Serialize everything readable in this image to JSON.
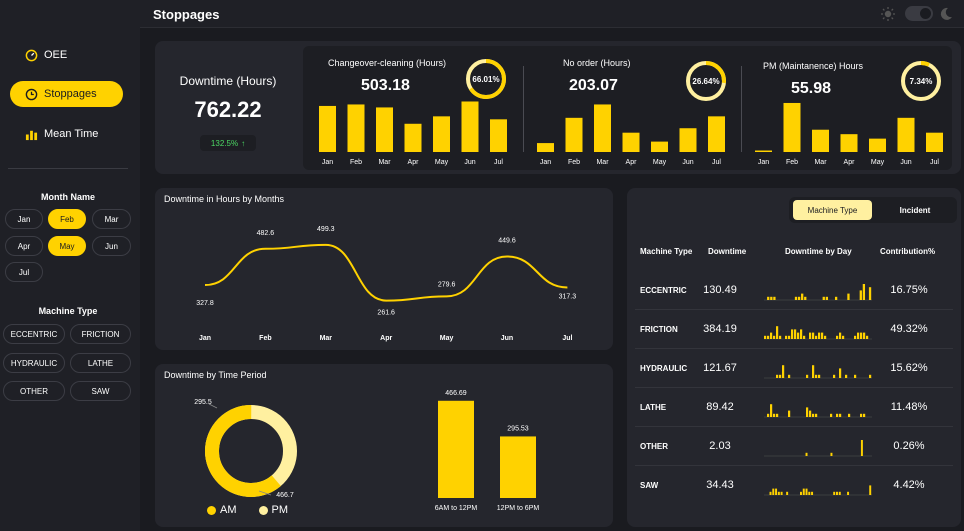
{
  "header": {
    "title": "Stoppages"
  },
  "sidebar": {
    "nav": [
      {
        "label": "OEE"
      },
      {
        "label": "Stoppages"
      },
      {
        "label": "Mean Time"
      }
    ],
    "month_title": "Month Name",
    "months": [
      "Jan",
      "Feb",
      "Mar",
      "Apr",
      "May",
      "Jun",
      "Jul"
    ],
    "selected_months": [
      "Feb",
      "May"
    ],
    "machine_title": "Machine Type",
    "machines": [
      "ECCENTRIC",
      "FRICTION",
      "HYDRAULIC",
      "LATHE",
      "OTHER",
      "SAW"
    ]
  },
  "kpi": {
    "label": "Downtime (Hours)",
    "value": "762.22",
    "change": "132.5%",
    "change_color": "#4cd964"
  },
  "mini_cards": [
    {
      "title": "Changeover-cleaning (Hours)",
      "value": "503.18",
      "pct": "66.01%",
      "fraction": 0.6601,
      "chart_data": {
        "type": "bar",
        "categories": [
          "Jan",
          "Feb",
          "Mar",
          "Apr",
          "May",
          "Jun",
          "Jul"
        ],
        "values": [
          3.1,
          3.2,
          3.0,
          1.9,
          2.4,
          3.4,
          2.2
        ]
      }
    },
    {
      "title": "No order (Hours)",
      "value": "203.07",
      "pct": "26.64%",
      "fraction": 0.2664,
      "chart_data": {
        "type": "bar",
        "categories": [
          "Jan",
          "Feb",
          "Mar",
          "Apr",
          "May",
          "Jun",
          "Jul"
        ],
        "values": [
          0.6,
          2.3,
          3.2,
          1.3,
          0.7,
          1.6,
          2.4
        ]
      }
    },
    {
      "title": "PM (Maintanence) Hours",
      "value": "55.98",
      "pct": "7.34%",
      "fraction": 0.0734,
      "chart_data": {
        "type": "bar",
        "categories": [
          "Jan",
          "Feb",
          "Mar",
          "Apr",
          "May",
          "Jun",
          "Jul"
        ],
        "values": [
          0.1,
          3.3,
          1.5,
          1.2,
          0.9,
          2.3,
          1.3
        ]
      }
    }
  ],
  "line_card": {
    "title": "Downtime in Hours by Months",
    "chart_data": {
      "type": "line",
      "categories": [
        "Jan",
        "Feb",
        "Mar",
        "Apr",
        "May",
        "Jun",
        "Jul"
      ],
      "values": [
        327.8,
        482.6,
        499.3,
        261.6,
        279.6,
        449.6,
        317.3
      ]
    }
  },
  "time_card": {
    "title": "Downtime by Time Period",
    "donut": {
      "chart_data": {
        "type": "pie",
        "categories": [
          "AM",
          "PM"
        ],
        "values": [
          466.7,
          295.5
        ]
      },
      "labels": [
        "295.5",
        "466.7"
      ],
      "legend": [
        "AM",
        "PM"
      ]
    },
    "bars": {
      "chart_data": {
        "type": "bar",
        "categories": [
          "6AM to 12PM",
          "12PM to 6PM"
        ],
        "values": [
          466.69,
          295.53
        ]
      },
      "labels": [
        "466.69",
        "295.53"
      ]
    }
  },
  "table_card": {
    "toggle": [
      "Machine Type",
      "Incident"
    ],
    "headers": [
      "Machine Type",
      "Downtime",
      "Downtime by Day",
      "Contribution%"
    ],
    "rows": [
      {
        "type": "ECCENTRIC",
        "downtime": "130.49",
        "contrib": "16.75%",
        "spark": [
          0,
          1,
          1,
          1,
          0,
          0,
          0,
          0,
          0,
          0,
          1,
          1,
          2,
          1,
          0,
          0,
          0,
          0,
          0,
          1,
          1,
          0,
          0,
          1,
          0,
          0,
          0,
          2,
          0,
          0,
          0,
          3,
          5,
          0,
          4
        ]
      },
      {
        "type": "FRICTION",
        "downtime": "384.19",
        "contrib": "49.32%",
        "spark": [
          1,
          1,
          2,
          1,
          4,
          1,
          0,
          1,
          1,
          3,
          3,
          2,
          3,
          1,
          0,
          2,
          2,
          1,
          2,
          2,
          1,
          0,
          0,
          0,
          1,
          2,
          1,
          0,
          0,
          0,
          1,
          2,
          2,
          2,
          1,
          0
        ]
      },
      {
        "type": "HYDRAULIC",
        "downtime": "121.67",
        "contrib": "15.62%",
        "spark": [
          0,
          0,
          0,
          0,
          1,
          1,
          4,
          0,
          1,
          0,
          0,
          0,
          0,
          0,
          1,
          0,
          4,
          1,
          1,
          0,
          0,
          0,
          0,
          1,
          0,
          3,
          0,
          1,
          0,
          0,
          1,
          0,
          0,
          0,
          0,
          1
        ]
      },
      {
        "type": "LATHE",
        "downtime": "89.42",
        "contrib": "11.48%",
        "spark": [
          0,
          1,
          4,
          1,
          1,
          0,
          0,
          0,
          2,
          0,
          0,
          0,
          0,
          0,
          3,
          2,
          1,
          1,
          0,
          0,
          0,
          0,
          1,
          0,
          1,
          1,
          0,
          0,
          1,
          0,
          0,
          0,
          1,
          1,
          0,
          0
        ]
      },
      {
        "type": "OTHER",
        "downtime": "2.03",
        "contrib": "0.26%",
        "spark": [
          0,
          0,
          0,
          0,
          0,
          0,
          0,
          0,
          0,
          0,
          0,
          0,
          0,
          0,
          0,
          1,
          0,
          0,
          0,
          0,
          0,
          0,
          0,
          0,
          1,
          0,
          0,
          0,
          0,
          0,
          0,
          0,
          0,
          0,
          0,
          5,
          0,
          0,
          0
        ]
      },
      {
        "type": "SAW",
        "downtime": "34.43",
        "contrib": "4.42%",
        "spark": [
          0,
          0,
          1,
          2,
          2,
          1,
          1,
          0,
          1,
          0,
          0,
          0,
          0,
          1,
          2,
          2,
          1,
          1,
          0,
          0,
          0,
          0,
          0,
          0,
          0,
          1,
          1,
          1,
          0,
          0,
          1,
          0,
          0,
          0,
          0,
          0,
          0,
          0,
          3
        ]
      }
    ]
  },
  "colors": {
    "accent": "#ffd200",
    "accent_light": "#fff0a0",
    "bg": "#1a1b20",
    "card": "#25262d"
  }
}
